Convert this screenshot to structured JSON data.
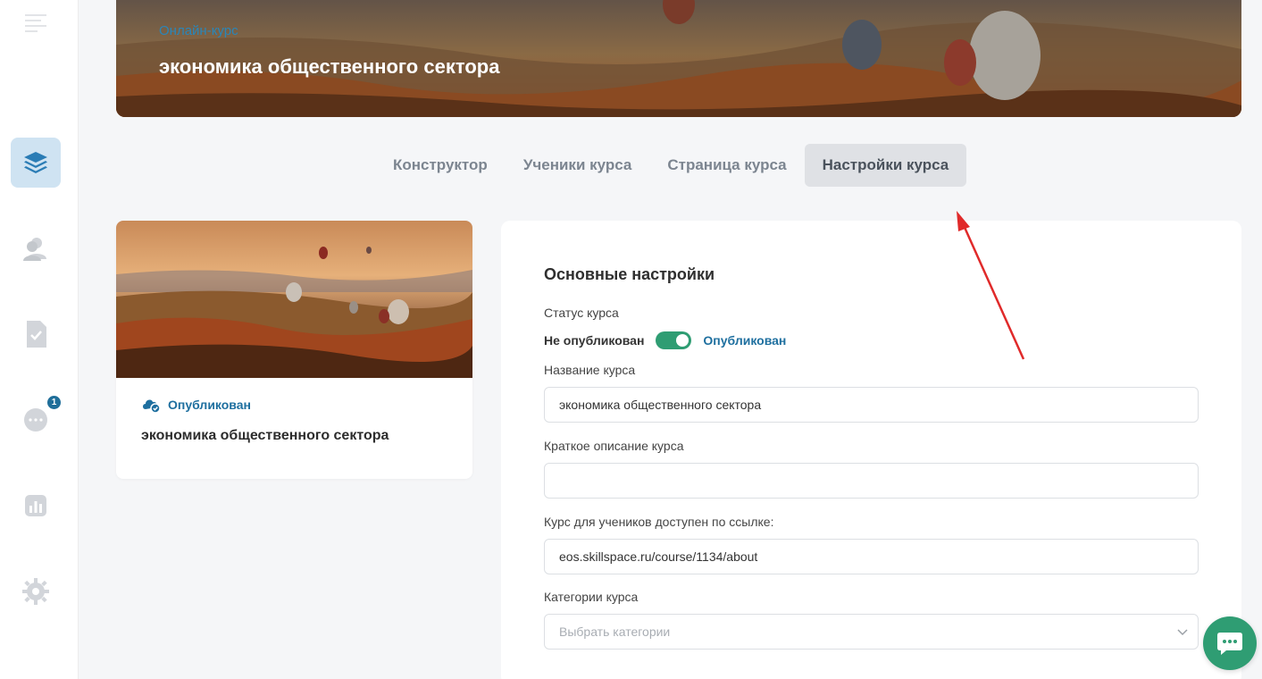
{
  "hero": {
    "subtitle": "Онлайн-курс",
    "title": "экономика общественного сектора"
  },
  "sidebar": {
    "items": [
      {
        "icon": "menu-icon"
      },
      {
        "icon": "courses-layers-icon",
        "active": true
      },
      {
        "icon": "users-icon"
      },
      {
        "icon": "tasks-check-icon"
      },
      {
        "icon": "chat-icon",
        "badge": "1"
      },
      {
        "icon": "analytics-icon"
      },
      {
        "icon": "settings-gear-icon"
      }
    ],
    "chat_badge": "1"
  },
  "tabs": [
    {
      "label": "Конструктор",
      "active": false
    },
    {
      "label": "Ученики курса",
      "active": false
    },
    {
      "label": "Страница курса",
      "active": false
    },
    {
      "label": "Настройки курса",
      "active": true
    }
  ],
  "preview_card": {
    "status": "Опубликован",
    "title": "экономика общественного сектора"
  },
  "settings": {
    "heading": "Основные настройки",
    "status_label": "Статус курса",
    "toggle_off_label": "Не опубликован",
    "toggle_on_label": "Опубликован",
    "toggle_state": true,
    "name_label": "Название курса",
    "name_value": "экономика общественного сектора",
    "description_label": "Краткое описание курса",
    "description_value": "",
    "link_label": "Курс для учеников доступен по ссылке:",
    "link_value": "eos.skillspace.ru/course/1134/about",
    "categories_label": "Категории курса",
    "categories_placeholder": "Выбрать категории"
  },
  "colors": {
    "accent_blue": "#1e6f9f",
    "toggle_green": "#2f9d73",
    "active_tab_bg": "#dfe1e5",
    "annotation_red": "#e02a2a"
  }
}
